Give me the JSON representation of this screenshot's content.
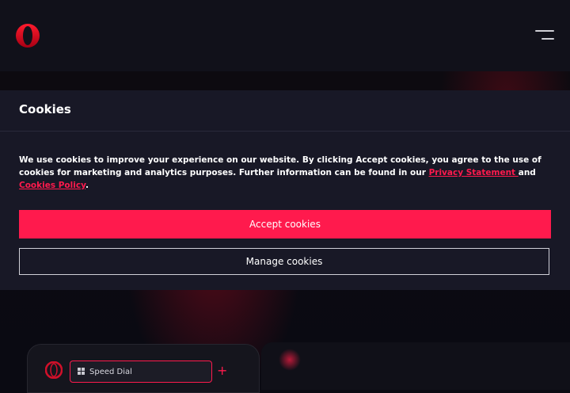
{
  "header": {
    "logo_icon": "opera-logo-icon",
    "menu_icon": "hamburger-menu-icon"
  },
  "cookie_banner": {
    "title": "Cookies",
    "text_before": "We use cookies to improve your experience on our website. By clicking Accept cookies, you agree to the use of cookies for marketing and analytics purposes. Further information can be found in our ",
    "privacy_link": "Privacy Statement ",
    "text_and": "and ",
    "cookies_link": "Cookies Policy",
    "text_after": ".",
    "accept_label": "Accept cookies",
    "manage_label": "Manage cookies"
  },
  "browser_preview": {
    "tab_label": "Speed Dial",
    "tab_icon": "grid-icon",
    "new_tab_icon": "plus-icon"
  },
  "colors": {
    "accent": "#ff1a4d",
    "panel": "#181826",
    "background": "#0a0a12"
  }
}
